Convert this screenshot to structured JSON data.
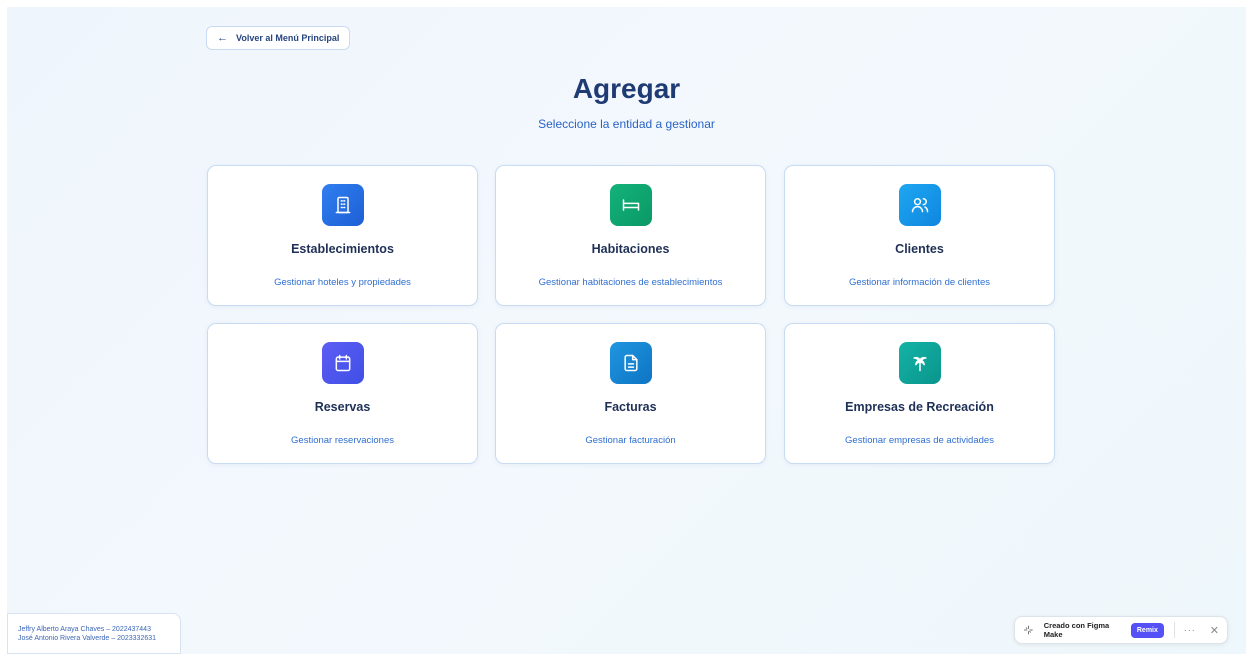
{
  "back_button": {
    "label": "Volver al Menú Principal",
    "icon": "arrow-left-icon"
  },
  "header": {
    "title": "Agregar",
    "subtitle": "Seleccione la entidad a gestionar"
  },
  "cards": [
    {
      "name": "Establecimientos",
      "description": "Gestionar hoteles y propiedades",
      "icon": "building-icon",
      "color_from": "#2f7fef",
      "color_to": "#1e5fd6"
    },
    {
      "name": "Habitaciones",
      "description": "Gestionar habitaciones de establecimientos",
      "icon": "bed-icon",
      "color_from": "#14b27a",
      "color_to": "#0a9966"
    },
    {
      "name": "Clientes",
      "description": "Gestionar información de clientes",
      "icon": "users-icon",
      "color_from": "#1ea7f0",
      "color_to": "#0f86e0"
    },
    {
      "name": "Reservas",
      "description": "Gestionar reservaciones",
      "icon": "calendar-icon",
      "color_from": "#5d5df3",
      "color_to": "#3f4fe6"
    },
    {
      "name": "Facturas",
      "description": "Gestionar facturación",
      "icon": "file-text-icon",
      "color_from": "#1f96e0",
      "color_to": "#0e74c4"
    },
    {
      "name": "Empresas de Recreación",
      "description": "Gestionar empresas de actividades",
      "icon": "palm-tree-icon",
      "color_from": "#14b3a6",
      "color_to": "#0a958c"
    }
  ],
  "credits": [
    "Jeffry Alberto Araya Chaves – 2022437443",
    "José Antonio Rivera Valverde – 2023332631"
  ],
  "figma_badge": {
    "label": "Creado con Figma Make",
    "remix_label": "Remix",
    "more_label": "···",
    "close_label": "✕",
    "accent": "#5551f6"
  }
}
